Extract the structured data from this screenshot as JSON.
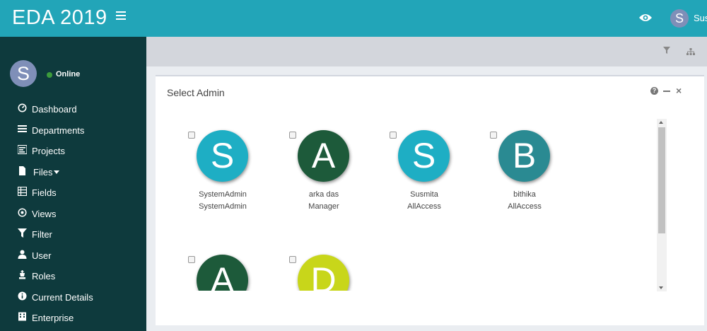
{
  "app": {
    "title": "EDA 2019"
  },
  "header": {
    "user_initial": "S",
    "user_name": "Sus"
  },
  "sidebar": {
    "user_initial": "S",
    "status": "Online",
    "items": [
      {
        "label": "Dashboard",
        "icon": "dashboard-icon"
      },
      {
        "label": "Departments",
        "icon": "list-icon"
      },
      {
        "label": "Projects",
        "icon": "tasks-icon"
      },
      {
        "label": "Files",
        "icon": "file-icon",
        "has_caret": true
      },
      {
        "label": "Fields",
        "icon": "table-icon"
      },
      {
        "label": "Views",
        "icon": "eye-circle-icon"
      },
      {
        "label": "Filter",
        "icon": "filter-icon"
      },
      {
        "label": "User",
        "icon": "user-icon"
      },
      {
        "label": "Roles",
        "icon": "chess-king-icon"
      },
      {
        "label": "Current Details",
        "icon": "info-icon"
      },
      {
        "label": "Enterprise",
        "icon": "building-icon"
      }
    ]
  },
  "panel": {
    "title": "Select Admin",
    "help_glyph": "?",
    "close_glyph": "×",
    "admins": [
      {
        "initial": "S",
        "name": "SystemAdmin",
        "role": "SystemAdmin",
        "color": "#1eaec4"
      },
      {
        "initial": "A",
        "name": "arka das",
        "role": "Manager",
        "color": "#1d5a3a"
      },
      {
        "initial": "S",
        "name": "Susmita",
        "role": "AllAccess",
        "color": "#1eaec4"
      },
      {
        "initial": "B",
        "name": "bithika",
        "role": "AllAccess",
        "color": "#2a8a92"
      },
      {
        "initial": "A",
        "name": "",
        "role": "",
        "color": "#1d5a3a"
      },
      {
        "initial": "D",
        "name": "",
        "role": "",
        "color": "#c8d61a"
      }
    ]
  },
  "colors": {
    "topbar": "#22a5b8",
    "sidebar": "#0e3a3d",
    "online": "#3c9b3c"
  }
}
